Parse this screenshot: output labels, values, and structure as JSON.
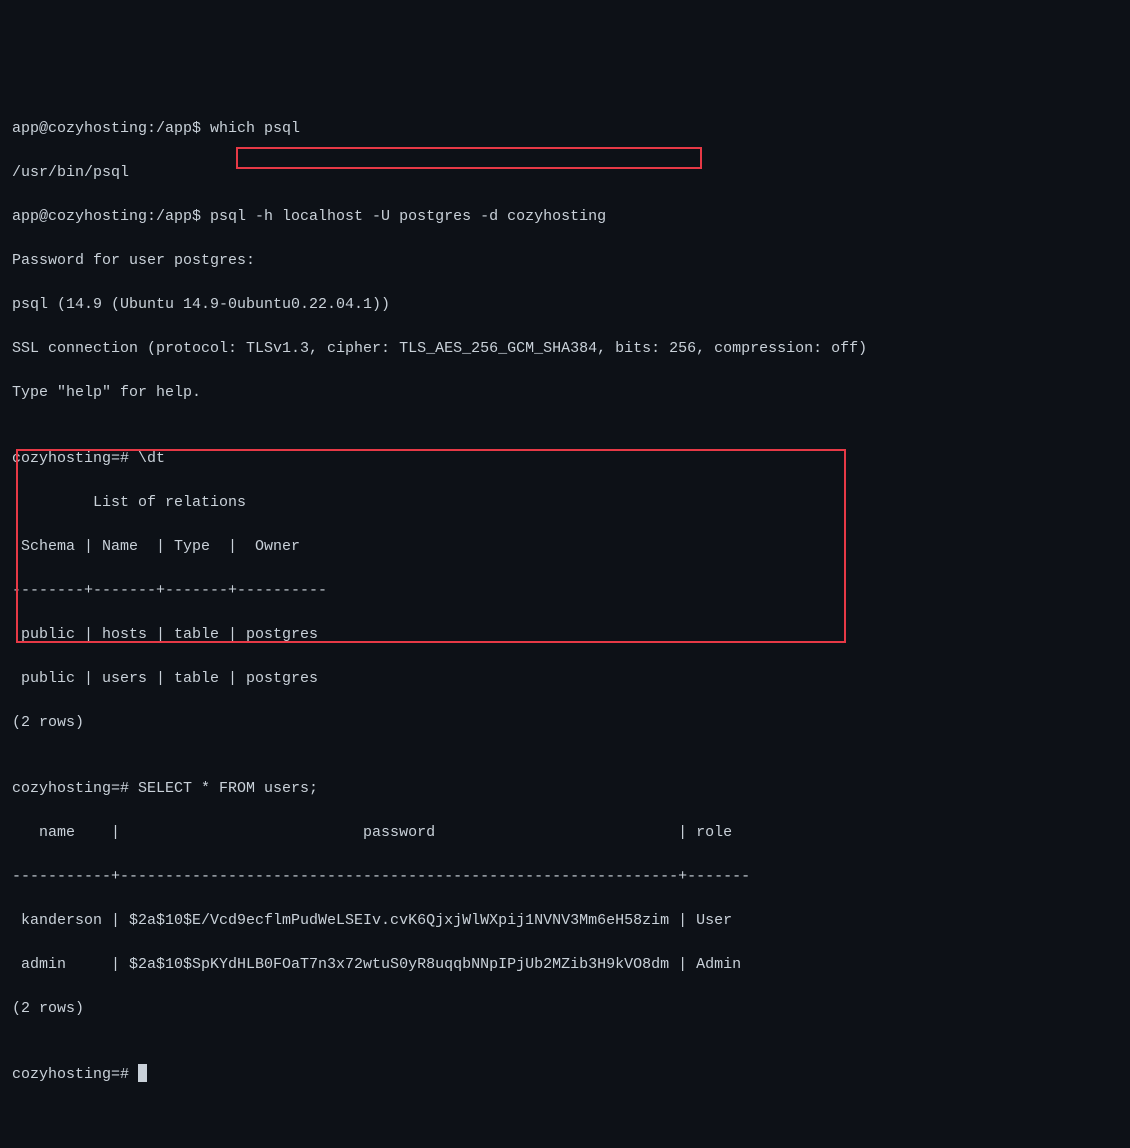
{
  "lines": {
    "l1": "app@cozyhosting:/app$ which psql",
    "l2": "/usr/bin/psql",
    "l3": "app@cozyhosting:/app$ psql -h localhost -U postgres -d cozyhosting",
    "l4": "Password for user postgres: ",
    "l5": "psql (14.9 (Ubuntu 14.9-0ubuntu0.22.04.1))",
    "l6": "SSL connection (protocol: TLSv1.3, cipher: TLS_AES_256_GCM_SHA384, bits: 256, compression: off)",
    "l7": "Type \"help\" for help.",
    "l8": "",
    "l9": "cozyhosting=# \\dt",
    "l10": "         List of relations",
    "l11": " Schema | Name  | Type  |  Owner   ",
    "l12": "--------+-------+-------+----------",
    "l13": " public | hosts | table | postgres",
    "l14": " public | users | table | postgres",
    "l15": "(2 rows)",
    "l16": "",
    "l17": "cozyhosting=# SELECT * FROM users;",
    "l18": "   name    |                           password                           | role  ",
    "l19": "-----------+--------------------------------------------------------------+-------",
    "l20": " kanderson | $2a$10$E/Vcd9ecflmPudWeLSEIv.cvK6QjxjWlWXpij1NVNV3Mm6eH58zim | User",
    "l21": " admin     | $2a$10$SpKYdHLB0FOaT7n3x72wtuS0yR8uqqbNNpIPjUb2MZib3H9kVO8dm | Admin",
    "l22": "(2 rows)",
    "l23": "",
    "l24": "cozyhosting=# "
  },
  "chart_data": {
    "type": "table",
    "tables": [
      {
        "title": "List of relations",
        "columns": [
          "Schema",
          "Name",
          "Type",
          "Owner"
        ],
        "rows": [
          [
            "public",
            "hosts",
            "table",
            "postgres"
          ],
          [
            "public",
            "users",
            "table",
            "postgres"
          ]
        ],
        "row_count": 2
      },
      {
        "title": "users",
        "columns": [
          "name",
          "password",
          "role"
        ],
        "rows": [
          [
            "kanderson",
            "$2a$10$E/Vcd9ecflmPudWeLSEIv.cvK6QjxjWlWXpij1NVNV3Mm6eH58zim",
            "User"
          ],
          [
            "admin",
            "$2a$10$SpKYdHLB0FOaT7n3x72wtuS0yR8uqqbNNpIPjUb2MZib3H9kVO8dm",
            "Admin"
          ]
        ],
        "row_count": 2
      }
    ]
  },
  "commands": {
    "cmd1": "which psql",
    "cmd2": "psql -h localhost -U postgres -d cozyhosting",
    "sql1": "\\dt",
    "sql2": "SELECT * FROM users;"
  },
  "prompts": {
    "shell": "app@cozyhosting:/app$",
    "psql": "cozyhosting=#"
  }
}
